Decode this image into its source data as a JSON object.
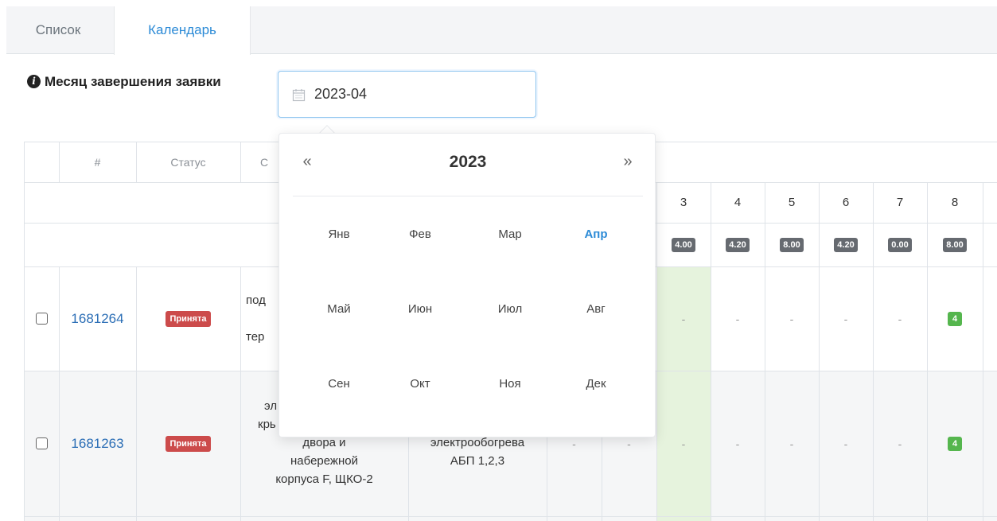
{
  "tabs": [
    {
      "label": "Список"
    },
    {
      "label": "Календарь"
    }
  ],
  "filter": {
    "label": "Месяц завершения заявки",
    "value": "2023-04"
  },
  "table": {
    "headers": {
      "num": "#",
      "status": "Статус",
      "partial": "С"
    },
    "day_numbers": [
      "3",
      "4",
      "5",
      "6",
      "7",
      "8"
    ],
    "day_hours": [
      "4.00",
      "4.20",
      "8.00",
      "4.20",
      "0.00",
      "8.00"
    ],
    "rows": [
      {
        "id": "1681264",
        "status": "Принята",
        "desc_partial": [
          "под",
          "",
          "тер"
        ],
        "cells": [
          "-",
          "-",
          "-",
          "-",
          "-",
          "4"
        ]
      },
      {
        "id": "1681263",
        "status": "Принята",
        "desc_partial": [
          "эл",
          "крь",
          "двора и",
          "набережной",
          "корпуса F, ЩКО-2"
        ],
        "work": [
          "электрообогрева",
          "АБП 1,2,3"
        ],
        "extra": [
          "-",
          "-"
        ],
        "cells": [
          "-",
          "-",
          "-",
          "-",
          "-",
          "4"
        ]
      }
    ]
  },
  "datepicker": {
    "year": "2023",
    "prev": "«",
    "next": "»",
    "months": [
      "Янв",
      "Фев",
      "Мар",
      "Апр",
      "Май",
      "Июн",
      "Июл",
      "Авг",
      "Сен",
      "Окт",
      "Ноя",
      "Дек"
    ],
    "selected": "Апр"
  },
  "colors": {
    "accent": "#2b8ad6",
    "status_red": "#cc4b4b",
    "badge_green": "#55b64e",
    "badge_dark": "#666a70",
    "highlight_column": "#e6f3dd"
  }
}
